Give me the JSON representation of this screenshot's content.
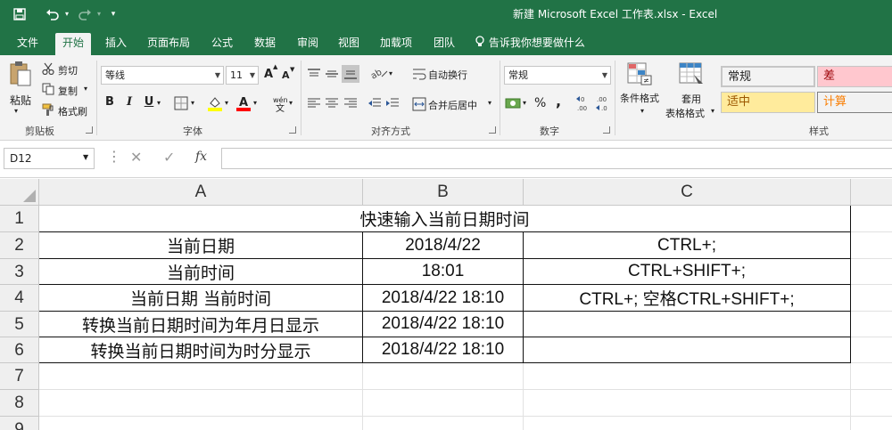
{
  "titlebar": {
    "window_title": "新建 Microsoft Excel 工作表.xlsx  -  Excel",
    "quick_access": {
      "save_icon": "save-icon",
      "undo_icon": "undo-icon",
      "redo_icon": "redo-icon"
    }
  },
  "tabs": [
    "文件",
    "开始",
    "插入",
    "页面布局",
    "公式",
    "数据",
    "审阅",
    "视图",
    "加载项",
    "团队"
  ],
  "active_tab": "开始",
  "tell_me": "告诉我你想要做什么",
  "ribbon": {
    "clipboard": {
      "paste": "粘贴",
      "cut": "剪切",
      "copy": "复制",
      "format_painter": "格式刷",
      "label": "剪贴板"
    },
    "font": {
      "name": "等线",
      "size": "11",
      "label": "字体",
      "bold": "B",
      "italic": "I",
      "underline": "U",
      "grow": "A",
      "shrink": "A"
    },
    "alignment": {
      "wrap": "自动换行",
      "merge": "合并后居中",
      "label": "对齐方式"
    },
    "number": {
      "format": "常规",
      "percent": "%",
      "comma": ",",
      "label": "数字"
    },
    "styles": {
      "conditional": "条件格式",
      "table_line1": "套用",
      "table_line2": "表格格式",
      "cells": [
        {
          "text": "常规",
          "bg": "#ffffff",
          "color": "#222222"
        },
        {
          "text": "差",
          "bg": "#ffc7ce",
          "color": "#9c0006"
        },
        {
          "text": "适中",
          "bg": "#ffeb9c",
          "color": "#9c5700"
        },
        {
          "text": "计算",
          "bg": "#f2f2f2",
          "color": "#fa7d00"
        }
      ],
      "label": "样式"
    }
  },
  "formula_bar": {
    "name_box": "D12",
    "fx": "fx",
    "content": ""
  },
  "columns": [
    "A",
    "B",
    "C"
  ],
  "rows": [
    "1",
    "2",
    "3",
    "4",
    "5",
    "6",
    "7",
    "8",
    "9"
  ],
  "sheet": {
    "title": "快速输入当前日期时间",
    "r2": {
      "a": "当前日期",
      "b": "2018/4/22",
      "c": "CTRL+;"
    },
    "r3": {
      "a": "当前时间",
      "b": "18:01",
      "c": "CTRL+SHIFT+;"
    },
    "r4": {
      "a": "当前日期 当前时间",
      "b": "2018/4/22 18:10",
      "c": "CTRL+; 空格CTRL+SHIFT+;"
    },
    "r5": {
      "a": "转换当前日期时间为年月日显示",
      "b": "2018/4/22 18:10",
      "c": ""
    },
    "r6": {
      "a": "转换当前日期时间为时分显示",
      "b": "2018/4/22 18:10",
      "c": ""
    }
  },
  "colors": {
    "excel_green": "#217346"
  }
}
